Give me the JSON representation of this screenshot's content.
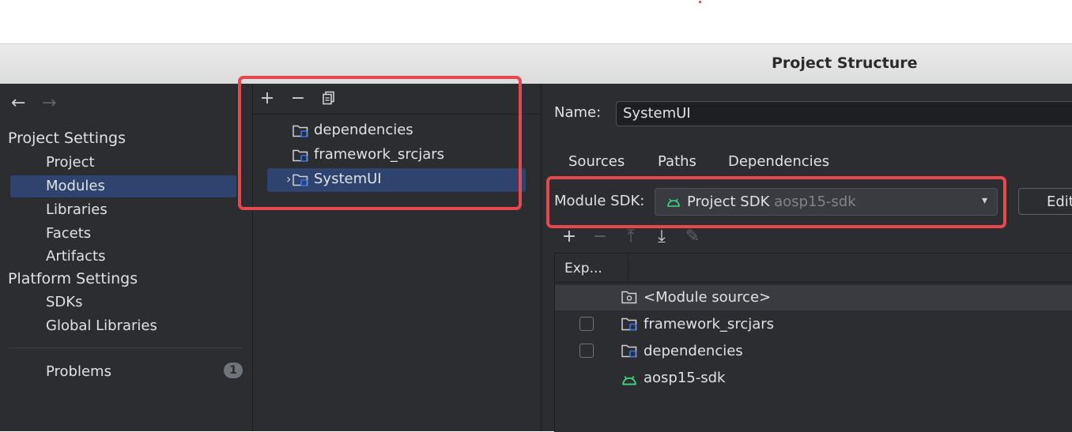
{
  "window": {
    "title": "Project Structure"
  },
  "nav": {
    "back_icon": "arrow-left-icon",
    "forward_icon": "arrow-right-icon",
    "project_settings": "Project Settings",
    "project_items": [
      "Project",
      "Modules",
      "Libraries",
      "Facets",
      "Artifacts"
    ],
    "selected": "Modules",
    "platform_settings": "Platform Settings",
    "platform_items": [
      "SDKs",
      "Global Libraries"
    ],
    "problems": {
      "label": "Problems",
      "count": "1"
    }
  },
  "module_tree": {
    "toolbar": [
      "add-icon",
      "remove-icon",
      "copy-icon"
    ],
    "items": [
      "dependencies",
      "framework_srcjars",
      "SystemUI"
    ],
    "selected": "SystemUI"
  },
  "module": {
    "name_label": "Name:",
    "name_value": "SystemUI",
    "tabs": [
      "Sources",
      "Paths",
      "Dependencies"
    ],
    "sdk_label": "Module SDK:",
    "sdk_value": "Project SDK",
    "sdk_sub": "aosp15-sdk",
    "edit_label": "Edit",
    "dep_toolbar": [
      "add-icon",
      "remove-icon",
      "move-up-icon",
      "move-down-icon",
      "edit-pencil-icon"
    ],
    "dep_column": "Exp...",
    "dependencies": [
      "<Module source>",
      "framework_srcjars",
      "dependencies",
      "aosp15-sdk"
    ]
  },
  "colors": {
    "background": "#2b2d30",
    "selection": "#2e436e",
    "highlight": "#e5484d",
    "android_green": "#3ddc84",
    "folder_badge": "#3574f0"
  }
}
